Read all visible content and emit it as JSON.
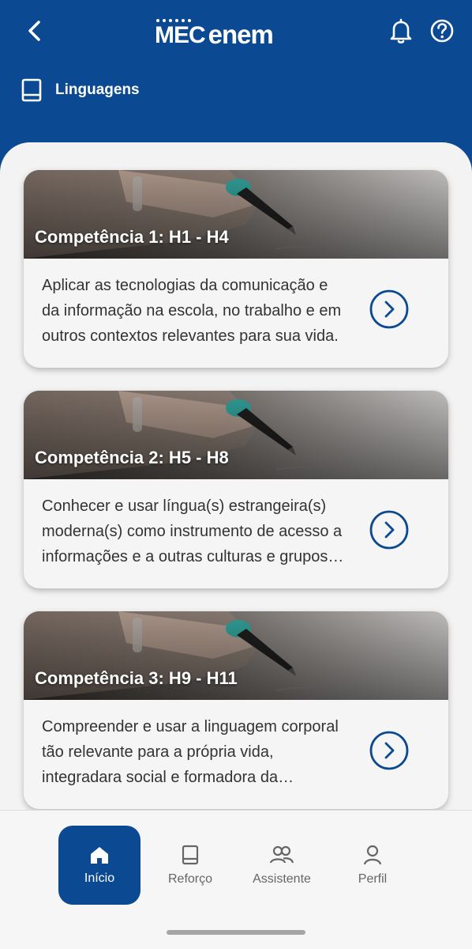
{
  "header": {
    "logo_mec": "MEC",
    "logo_enem": "enem",
    "subject": "Linguagens"
  },
  "cards": [
    {
      "title": "Competência 1: H1 - H4",
      "description": "Aplicar as tecnologias da comunicação e da informação na escola, no trabalho e em outros contextos relevantes para sua vida."
    },
    {
      "title": "Competência 2: H5 - H8",
      "description": "Conhecer e usar língua(s) estrangeira(s) moderna(s) como instrumento de acesso a informações e a outras culturas e grupos sociais."
    },
    {
      "title": "Competência 3: H9 - H11",
      "description": "Compreender e usar a linguagem corporal tão relevante para a própria vida, integradara social e formadora da identidade."
    }
  ],
  "bottom_nav": [
    {
      "label": "Início",
      "icon": "home-icon",
      "active": true
    },
    {
      "label": "Reforço",
      "icon": "book-icon",
      "active": false
    },
    {
      "label": "Assistente",
      "icon": "users-icon",
      "active": false
    },
    {
      "label": "Perfil",
      "icon": "user-icon",
      "active": false
    }
  ],
  "colors": {
    "primary": "#0b4a92",
    "background": "#f3f3f3",
    "card": "#f5f5f6",
    "text": "#333333",
    "muted": "#666666"
  }
}
